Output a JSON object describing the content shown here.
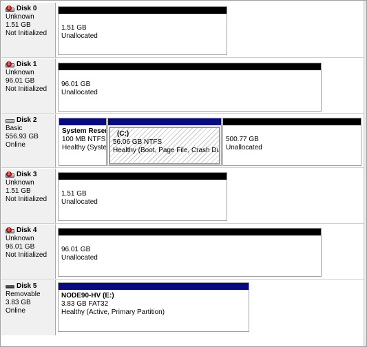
{
  "disks": [
    {
      "name": "Disk 0",
      "type": "Unknown",
      "size": "1.51 GB",
      "status": "Not Initialized",
      "partitions": [
        {
          "line1": "1.51 GB",
          "line2": "Unallocated"
        }
      ]
    },
    {
      "name": "Disk 1",
      "type": "Unknown",
      "size": "96.01 GB",
      "status": "Not Initialized",
      "partitions": [
        {
          "line1": "96.01 GB",
          "line2": "Unallocated"
        }
      ]
    },
    {
      "name": "Disk 2",
      "type": "Basic",
      "size": "556.93 GB",
      "status": "Online",
      "partitions": [
        {
          "label": "System Reser",
          "line1": "100 MB NTFS",
          "line2": "Healthy (Syste"
        },
        {
          "label": "(C:)",
          "line1": "56.06 GB NTFS",
          "line2": "Healthy (Boot, Page File, Crash Dump"
        },
        {
          "line1": "500.77 GB",
          "line2": "Unallocated"
        }
      ]
    },
    {
      "name": "Disk 3",
      "type": "Unknown",
      "size": "1.51 GB",
      "status": "Not Initialized",
      "partitions": [
        {
          "line1": "1.51 GB",
          "line2": "Unallocated"
        }
      ]
    },
    {
      "name": "Disk 4",
      "type": "Unknown",
      "size": "96.01 GB",
      "status": "Not Initialized",
      "partitions": [
        {
          "line1": "96.01 GB",
          "line2": "Unallocated"
        }
      ]
    },
    {
      "name": "Disk 5",
      "type": "Removable",
      "size": "3.83 GB",
      "status": "Online",
      "partitions": [
        {
          "label": "NODE90-HV  (E:)",
          "line1": "3.83 GB FAT32",
          "line2": "Healthy (Active, Primary Partition)"
        }
      ]
    }
  ],
  "colors": {
    "unallocated_bar": "#000000",
    "primary_bar": "#0a0a80",
    "info_background": "#f0f0f0"
  }
}
